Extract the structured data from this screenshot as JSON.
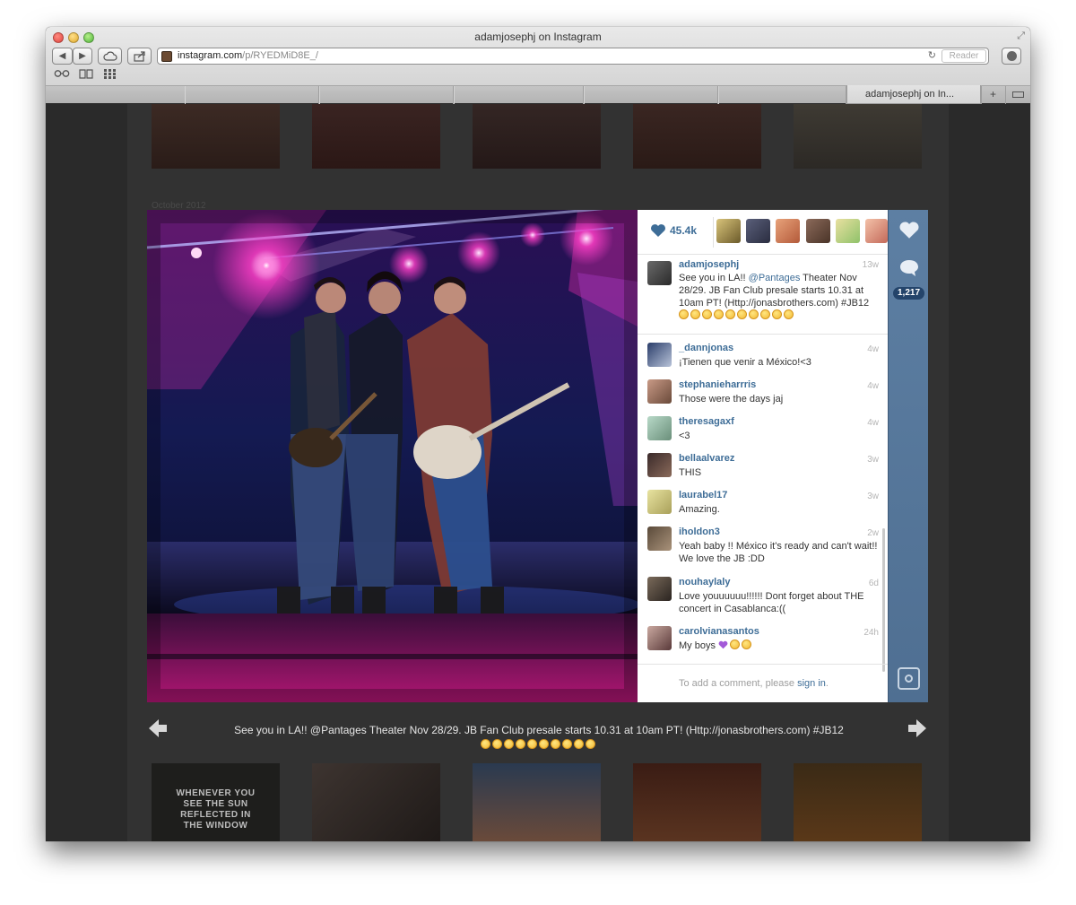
{
  "window": {
    "title": "adamjosephj on Instagram"
  },
  "toolbar": {
    "back_icon": "chevron-left-icon",
    "forward_icon": "chevron-right-icon",
    "icloud_icon": "cloud-icon",
    "share_icon": "share-icon",
    "url_domain": "instagram.com",
    "url_path": "/p/RYEDMiD8E_/",
    "reload_icon": "reload-icon",
    "reader_label": "Reader",
    "download_icon": "download-icon"
  },
  "bookmarks_bar": {
    "icons": [
      "reading-list-icon",
      "bookmarks-icon",
      "top-sites-icon"
    ]
  },
  "tabs": {
    "active_label": "adamjosephj on In...",
    "add_icon": "plus-icon",
    "list_icon": "tab-list-icon"
  },
  "page": {
    "month_label": "October 2012"
  },
  "thumbnails": {
    "bottom_first_text": "WHENEVER YOU SEE THE SUN REFLECTED IN THE WINDOW"
  },
  "post": {
    "likes_count": "45.4k",
    "comments_count": "1,217",
    "caption": {
      "username": "adamjosephj",
      "time": "13w",
      "text_before_mention": "See you in LA!! ",
      "mention": "@Pantages",
      "text_after_mention": " Theater Nov 28/29. JB Fan Club presale starts 10.31 at 10am PT! (Http://jonasbrothers.com) #JB12"
    },
    "comments": [
      {
        "username": "_dannjonas",
        "time": "4w",
        "text": "¡Tienen que venir a México!<3"
      },
      {
        "username": "stephanieharrris",
        "time": "4w",
        "text": "Those were the days jaj"
      },
      {
        "username": "theresagaxf",
        "time": "4w",
        "text": "<3"
      },
      {
        "username": "bellaalvarez",
        "time": "3w",
        "text": "THIS"
      },
      {
        "username": "laurabel17",
        "time": "3w",
        "text": "Amazing."
      },
      {
        "username": "iholdon3",
        "time": "2w",
        "text": "Yeah baby !! México it's ready and can't wait!! We love the JB :DD"
      },
      {
        "username": "nouhaylaly",
        "time": "6d",
        "text": "Love youuuuuu!!!!!! Dont forget about THE concert in Casablanca:(("
      },
      {
        "username": "carolvianasantos",
        "time": "24h",
        "text": "My boys "
      }
    ],
    "signin_prefix": "To add a comment, please ",
    "signin_link": "sign in",
    "signin_suffix": ".",
    "lightbox_caption": "See you in LA!! @Pantages Theater Nov 28/29. JB Fan Club presale starts 10.31 at 10am PT! (Http://jonasbrothers.com) #JB12"
  },
  "icons": {
    "like": "heart-icon",
    "comment": "speech-bubble-icon",
    "camera": "instagram-camera-icon",
    "prev": "arrow-left-icon",
    "next": "arrow-right-icon"
  },
  "colors": {
    "instagram_blue": "#3e6d97",
    "action_bar": "#5d7fa3"
  }
}
